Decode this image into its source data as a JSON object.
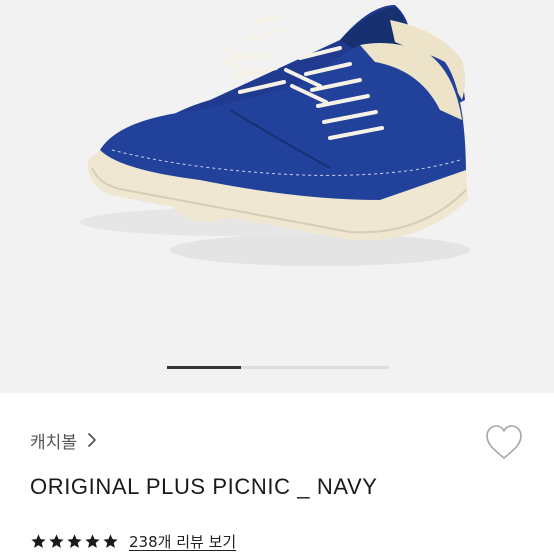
{
  "product": {
    "brand": "캐치볼",
    "title": "ORIGINAL PLUS PICNIC _ NAVY",
    "rating_stars": 5,
    "review_link": "238개 리뷰 보기"
  },
  "gallery": {
    "image_count": 3,
    "current_index": 1,
    "image_subject": "navy canvas low-top sneakers"
  },
  "icons": {
    "brand_chevron": "chevron-right-icon",
    "wishlist": "heart-outline-icon",
    "star": "star-icon"
  },
  "colors": {
    "canvas_navy": "#1f3a8f",
    "sole_cream": "#eee6cf",
    "background": "#f2f2f2",
    "star": "#1a1a1a"
  }
}
